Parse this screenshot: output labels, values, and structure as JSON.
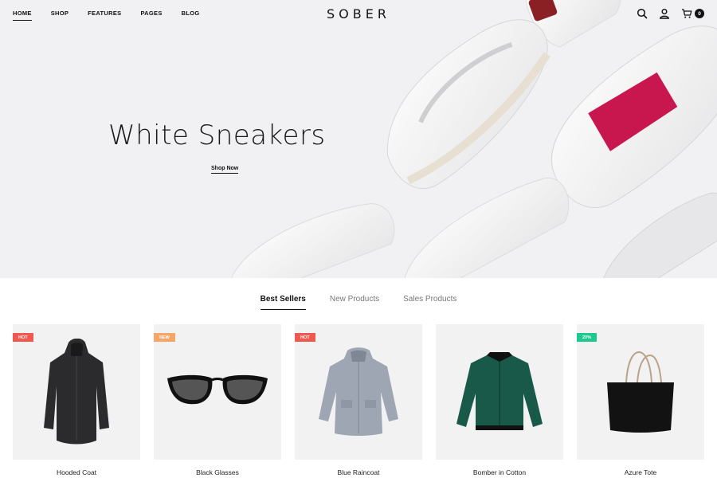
{
  "header": {
    "nav": [
      {
        "label": "HOME"
      },
      {
        "label": "SHOP"
      },
      {
        "label": "FEATURES"
      },
      {
        "label": "PAGES"
      },
      {
        "label": "BLOG"
      }
    ],
    "logo": "SOBER",
    "cart_count": "0"
  },
  "hero": {
    "title": "White Sneakers",
    "cta": "Shop Now"
  },
  "tabs": [
    {
      "label": "Best Sellers"
    },
    {
      "label": "New Products"
    },
    {
      "label": "Sales Products"
    }
  ],
  "products": [
    {
      "name": "Hooded Coat",
      "badge": "HOT",
      "badge_color": "#f0594f"
    },
    {
      "name": "Black Glasses",
      "badge": "NEW",
      "badge_color": "#f7a66a"
    },
    {
      "name": "Blue Raincoat",
      "badge": "HOT",
      "badge_color": "#f0594f"
    },
    {
      "name": "Bomber in Cotton",
      "badge": "",
      "badge_color": ""
    },
    {
      "name": "Azure Tote",
      "badge": "20%",
      "badge_color": "#1dc98f"
    }
  ],
  "colors": {
    "accent_stripe": "#c8174e",
    "hero_bg": "#f1f1f3"
  }
}
